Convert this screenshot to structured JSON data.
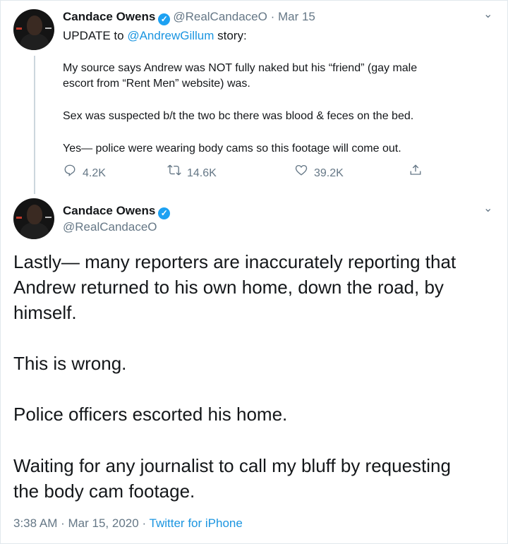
{
  "tweet1": {
    "author_name": "Candace Owens",
    "handle": "@RealCandaceO",
    "separator": "·",
    "date": "Mar 15",
    "intro_prefix": "UPDATE to ",
    "mention": "@AndrewGillum",
    "intro_suffix": " story:",
    "para1_line1": "My source says Andrew was NOT fully naked but his “friend” (gay male",
    "para1_line2": "escort from “Rent Men” website) was.",
    "para2": "Sex was suspected b/t the two bc there was blood & feces on the bed.",
    "para3": "Yes— police were wearing body cams so this footage will come out.",
    "replies": "4.2K",
    "retweets": "14.6K",
    "likes": "39.2K",
    "verified_glyph": "✓",
    "chevron_glyph": "⌄",
    "icons": [
      "reply-icon",
      "retweet-icon",
      "like-icon",
      "share-icon"
    ]
  },
  "tweet2": {
    "author_name": "Candace Owens",
    "handle": "@RealCandaceO",
    "verified_glyph": "✓",
    "chevron_glyph": "⌄",
    "body_line1": "Lastly— many reporters are inaccurately reporting that",
    "body_line2": "Andrew returned to his own home, down the road, by",
    "body_line3": "himself.",
    "body_para2": "This is wrong.",
    "body_para3": "Police officers escorted his home.",
    "body_para4_line1": "Waiting for any journalist to call my bluff by requesting",
    "body_para4_line2": "the body cam footage.",
    "time": "3:38 AM",
    "separator": "·",
    "full_date": "Mar 15, 2020",
    "source": "Twitter for iPhone"
  },
  "colors": {
    "accent": "#1da1f2",
    "link": "#1b95e0",
    "muted": "#657786",
    "text": "#14171a",
    "border": "#e1e8ed"
  }
}
